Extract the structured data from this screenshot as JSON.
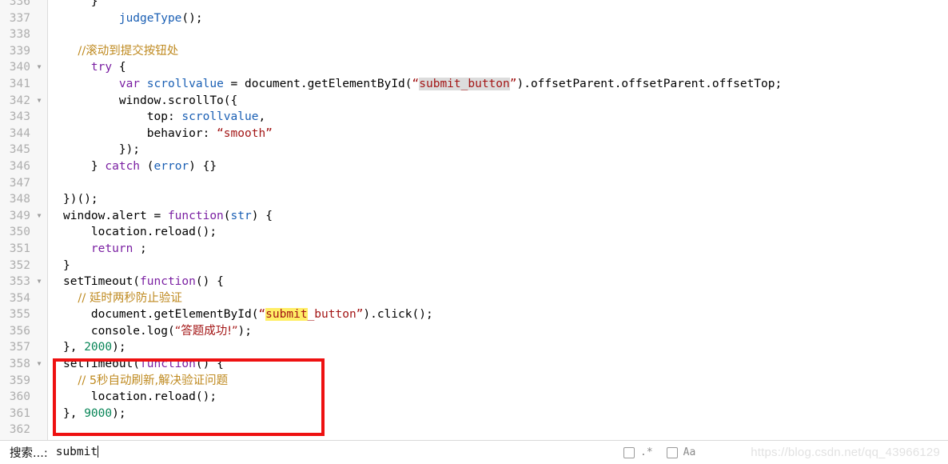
{
  "editor": {
    "first_partial_line": "336",
    "lines": [
      {
        "num": "337",
        "fold": false
      },
      {
        "num": "338",
        "fold": false
      },
      {
        "num": "339",
        "fold": false
      },
      {
        "num": "340",
        "fold": true
      },
      {
        "num": "341",
        "fold": false
      },
      {
        "num": "342",
        "fold": true
      },
      {
        "num": "343",
        "fold": false
      },
      {
        "num": "344",
        "fold": false
      },
      {
        "num": "345",
        "fold": false
      },
      {
        "num": "346",
        "fold": false
      },
      {
        "num": "347",
        "fold": false
      },
      {
        "num": "348",
        "fold": false
      },
      {
        "num": "349",
        "fold": true
      },
      {
        "num": "350",
        "fold": false
      },
      {
        "num": "351",
        "fold": false
      },
      {
        "num": "352",
        "fold": false
      },
      {
        "num": "353",
        "fold": true
      },
      {
        "num": "354",
        "fold": false
      },
      {
        "num": "355",
        "fold": false
      },
      {
        "num": "356",
        "fold": false
      },
      {
        "num": "357",
        "fold": false
      },
      {
        "num": "358",
        "fold": true
      },
      {
        "num": "359",
        "fold": false
      },
      {
        "num": "360",
        "fold": false
      },
      {
        "num": "361",
        "fold": false
      },
      {
        "num": "362",
        "fold": false
      }
    ],
    "code": {
      "l337_indent": "        ",
      "l337_fn": "judgeType",
      "l337_tail": "();",
      "l339_comment": "    //滚动到提交按钮处",
      "l340_indent": "    ",
      "l340_kw": "try",
      "l340_tail": " {",
      "l341_indent": "        ",
      "l341_kw": "var",
      "l341_var": " scrollvalue",
      "l341_mid": " = document.getElementById(",
      "l341_q1": "“",
      "l341_hl": "submit_button",
      "l341_q2": "”",
      "l341_tail": ").offsetParent.offsetParent.offsetTop;",
      "l342": "        window.scrollTo({",
      "l343_indent": "            top: ",
      "l343_var": "scrollvalue",
      "l343_tail": ",",
      "l344_indent": "            behavior: ",
      "l344_str": "“smooth”",
      "l345": "        });",
      "l346_indent": "    } ",
      "l346_kw": "catch",
      "l346_mid": " (",
      "l346_var": "error",
      "l346_tail": ") {}",
      "l348": "})();",
      "l349_pre": "window.alert = ",
      "l349_kw": "function",
      "l349_p1": "(",
      "l349_var": "str",
      "l349_tail": ") {",
      "l350": "    location.reload();",
      "l351_indent": "    ",
      "l351_kw": "return",
      "l351_tail": " ;",
      "l352": "}",
      "l353_pre": "setTimeout(",
      "l353_kw": "function",
      "l353_tail": "() {",
      "l354_comment": "    // 延时两秒防止验证",
      "l355_indent": "    document.getElementById(",
      "l355_q1": "“",
      "l355_hl": "submit",
      "l355_rest": "_button",
      "l355_q2": "”",
      "l355_tail": ").click();",
      "l356_indent": "    console.log(",
      "l356_str": "“答题成功!”",
      "l356_tail": ");",
      "l357_pre": "}, ",
      "l357_num": "2000",
      "l357_tail": ");",
      "l358_pre": "setTimeout(",
      "l358_kw": "function",
      "l358_tail": "() {",
      "l359_comment": "    // 5秒自动刷新,解决验证问题",
      "l360": "    location.reload();",
      "l361_pre": "}, ",
      "l361_num": "9000",
      "l361_tail": ");"
    }
  },
  "annotation": {
    "red_box_color": "#ee1111"
  },
  "searchbar": {
    "label": "搜索...:",
    "query": "submit",
    "regex_label": ".*",
    "case_label": "Aa",
    "regex_checked": false,
    "case_checked": false
  },
  "watermark": {
    "text": "https://blog.csdn.net/qq_43966129"
  },
  "colors": {
    "keyword": "#7a1fa2",
    "function": "#1a5fb4",
    "string": "#a31515",
    "comment": "#bf8a20",
    "number": "#098658",
    "highlight_all": "#dcdcdc",
    "highlight_current": "#ffee66",
    "gutter_bg": "#f7f7f7",
    "line_number": "#aeaeae"
  }
}
